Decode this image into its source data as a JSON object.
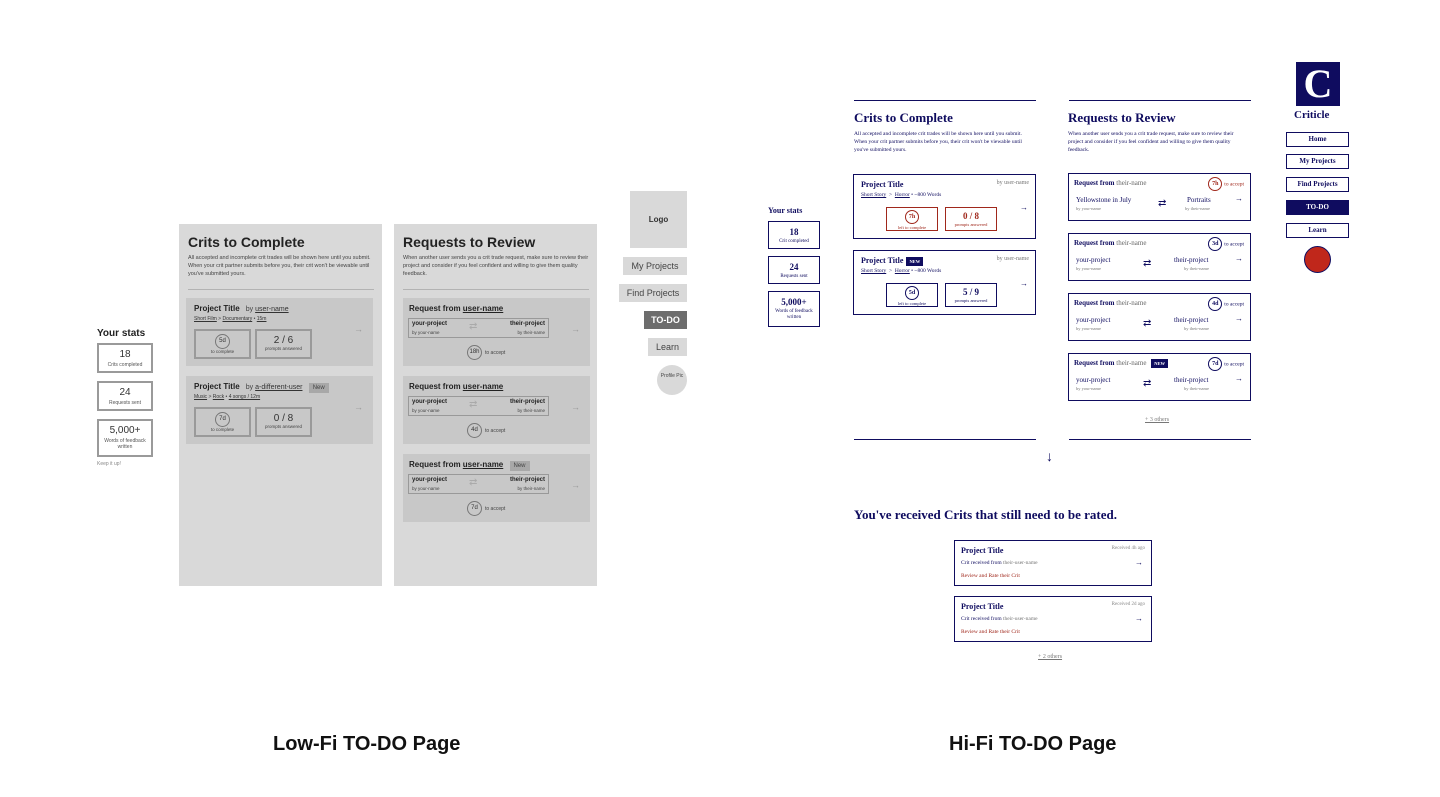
{
  "lowfi": {
    "stats_title": "Your stats",
    "stats": [
      {
        "value": "18",
        "label": "Crits completed"
      },
      {
        "value": "24",
        "label": "Requests sent"
      },
      {
        "value": "5,000+",
        "label": "Words of feedback written"
      }
    ],
    "keep": "Keep it up!",
    "crits": {
      "title": "Crits to Complete",
      "desc": "All accepted and incomplete crit trades will be shown here until you submit. When your crit partner submits before you, their crit won't be viewable until you've submitted yours.",
      "cards": [
        {
          "title": "Project Title",
          "by": "by",
          "user": "user-name",
          "new": "",
          "genre": "Short Film",
          "sub": "Documentary",
          "length": "15m",
          "days": "5d",
          "days_label": "to complete",
          "prompts": "2 / 6",
          "prompts_label": "prompts answered"
        },
        {
          "title": "Project Title",
          "by": "by",
          "user": "a-different-user",
          "new": "New",
          "genre": "Music",
          "sub": "Rock",
          "length": "4 songs / 12m",
          "days": "7d",
          "days_label": "to complete",
          "prompts": "0 / 8",
          "prompts_label": "prompts answered"
        }
      ]
    },
    "requests": {
      "title": "Requests to Review",
      "desc": "When another user sends you a crit trade request, make sure to review their project and consider if you feel confident and willing to give them quality feedback.",
      "cards": [
        {
          "from": "Request from",
          "user": "user-name",
          "new": "",
          "mine": "your-project",
          "mine_by": "by your-name",
          "theirs": "their-project",
          "theirs_by": "by their-name",
          "time": "18h",
          "accept": "to accept"
        },
        {
          "from": "Request from",
          "user": "user-name",
          "new": "",
          "mine": "your-project",
          "mine_by": "by your-name",
          "theirs": "their-project",
          "theirs_by": "by their-name",
          "time": "4d",
          "accept": "to accept"
        },
        {
          "from": "Request from",
          "user": "user-name",
          "new": "New",
          "mine": "your-project",
          "mine_by": "by your-name",
          "theirs": "their-project",
          "theirs_by": "by their-name",
          "time": "7d",
          "accept": "to accept"
        }
      ]
    },
    "nav": {
      "logo": "Logo",
      "items": [
        "My Projects",
        "Find Projects",
        "TO-DO",
        "Learn"
      ],
      "profile": "Profile Pic"
    },
    "caption": "Low-Fi TO-DO Page"
  },
  "hifi": {
    "stats_title": "Your stats",
    "stats": [
      {
        "value": "18",
        "label": "Crit completed"
      },
      {
        "value": "24",
        "label": "Requests sent"
      },
      {
        "value": "5,000+",
        "label": "Words of feedback written"
      }
    ],
    "crits": {
      "title": "Crits to Complete",
      "desc": "All accepted and incomplete crit trades will be shown here until you submit. When your crit partner submits before you, their crit won't be viewable until you've submitted yours.",
      "cards": [
        {
          "title": "Project Title",
          "new": "",
          "by": "by user-name",
          "genre": "Short Story",
          "sub": "Horror",
          "words": "~800 Words",
          "time": "7h",
          "time_label": "left to complete",
          "prompts": "0 / 8",
          "prompts_label": "prompts answered",
          "urgent": true
        },
        {
          "title": "Project Title",
          "new": "NEW",
          "by": "by user-name",
          "genre": "Short Story",
          "sub": "Horror",
          "words": "~800 Words",
          "time": "5d",
          "time_label": "left to complete",
          "prompts": "5 / 9",
          "prompts_label": "prompts answered",
          "urgent": false
        }
      ]
    },
    "requests": {
      "title": "Requests to Review",
      "desc": "When another user sends you a crit trade request, make sure to review their project and consider if you feel confident and willing to give them quality feedback.",
      "cards": [
        {
          "from": "Request from",
          "user": "their-name",
          "new": "",
          "time": "7h",
          "accept": "to accept",
          "mine": "Yellowstone in July",
          "mine_by": "by your-name",
          "theirs": "Portraits",
          "theirs_by": "by their-name",
          "urgent": true
        },
        {
          "from": "Request from",
          "user": "their-name",
          "new": "",
          "time": "3d",
          "accept": "to accept",
          "mine": "your-project",
          "mine_by": "by your-name",
          "theirs": "their-project",
          "theirs_by": "by their-name",
          "urgent": false
        },
        {
          "from": "Request from",
          "user": "their-name",
          "new": "",
          "time": "4d",
          "accept": "to accept",
          "mine": "your-project",
          "mine_by": "by your-name",
          "theirs": "their-project",
          "theirs_by": "by their-name",
          "urgent": false
        },
        {
          "from": "Request from",
          "user": "their-name",
          "new": "NEW",
          "time": "7d",
          "accept": "to accept",
          "mine": "your-project",
          "mine_by": "by your-name",
          "theirs": "their-project",
          "theirs_by": "by their-name",
          "urgent": false
        }
      ],
      "others": "+ 3 others"
    },
    "brand": {
      "letter": "C",
      "name": "Criticle"
    },
    "nav": [
      "Home",
      "My Projects",
      "Find Projects",
      "TO-DO",
      "Learn"
    ],
    "rated": {
      "title": "You've received Crits that still need to be rated.",
      "cards": [
        {
          "title": "Project Title",
          "received": "Received 4h ago",
          "from": "Crit received from",
          "user": "their-user-name",
          "rate": "Review and Rate their Crit"
        },
        {
          "title": "Project Title",
          "received": "Received 2d ago",
          "from": "Crit received from",
          "user": "their-user-name",
          "rate": "Review and Rate their Crit"
        }
      ],
      "others": "+ 2 others"
    },
    "caption": "Hi-Fi TO-DO Page"
  }
}
